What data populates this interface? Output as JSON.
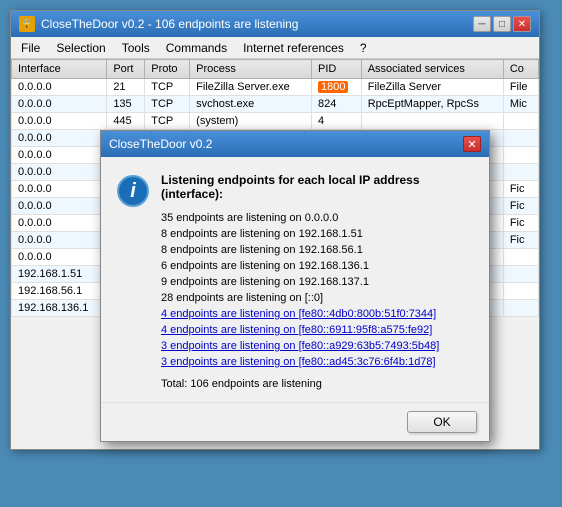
{
  "mainWindow": {
    "title": "CloseTheDoor v0.2 - 106 endpoints are listening",
    "icon": "🔒"
  },
  "menuBar": {
    "items": [
      "File",
      "Selection",
      "Tools",
      "Commands",
      "Internet references",
      "?"
    ]
  },
  "table": {
    "columns": [
      "Interface",
      "Port",
      "Proto",
      "Process",
      "PID",
      "Associated services",
      "Co"
    ],
    "rows": [
      {
        "interface": "0.0.0.0",
        "port": "21",
        "proto": "TCP",
        "process": "FileZilla Server.exe",
        "pid": "1800",
        "pid_highlight": true,
        "services": "FileZilla Server",
        "co": "File",
        "selected": false
      },
      {
        "interface": "0.0.0.0",
        "port": "135",
        "proto": "TCP",
        "process": "svchost.exe",
        "pid": "824",
        "pid_highlight": false,
        "services": "RpcEptMapper, RpcSs",
        "co": "Mic",
        "selected": false
      },
      {
        "interface": "0.0.0.0",
        "port": "445",
        "proto": "TCP",
        "process": "(system)",
        "pid": "4",
        "pid_highlight": false,
        "services": "",
        "co": "",
        "selected": false
      },
      {
        "interface": "0.0.0.0",
        "port": "",
        "proto": "",
        "process": "",
        "pid": "",
        "pid_highlight": false,
        "services": "",
        "co": "",
        "selected": false
      },
      {
        "interface": "0.0.0.0",
        "port": "",
        "proto": "",
        "process": "",
        "pid": "",
        "pid_highlight": false,
        "services": "",
        "co": "",
        "selected": false
      },
      {
        "interface": "0.0.0.0",
        "port": "",
        "proto": "",
        "process": "",
        "pid": "",
        "pid_highlight": false,
        "services": "",
        "co": "",
        "selected": false
      },
      {
        "interface": "0.0.0.0",
        "port": "",
        "proto": "",
        "process": "",
        "pid": "",
        "pid_highlight": false,
        "services": "",
        "co": "Fic",
        "selected": false
      },
      {
        "interface": "0.0.0.0",
        "port": "",
        "proto": "",
        "process": "",
        "pid": "",
        "pid_highlight": false,
        "services": "",
        "co": "Fic",
        "selected": false
      },
      {
        "interface": "0.0.0.0",
        "port": "",
        "proto": "",
        "process": "",
        "pid": "",
        "pid_highlight": false,
        "services": "",
        "co": "Fic",
        "selected": false
      },
      {
        "interface": "0.0.0.0",
        "port": "",
        "proto": "",
        "process": "",
        "pid": "",
        "pid_highlight": false,
        "services": "",
        "co": "Fic",
        "selected": false
      },
      {
        "interface": "0.0.0.0",
        "port": "",
        "proto": "",
        "process": "",
        "pid": "",
        "pid_highlight": false,
        "services": "",
        "co": "",
        "selected": false
      },
      {
        "interface": "192.168.1.51",
        "port": "",
        "proto": "",
        "process": "",
        "pid": "",
        "pid_highlight": false,
        "services": "",
        "co": "",
        "selected": false
      },
      {
        "interface": "192.168.56.1",
        "port": "",
        "proto": "",
        "process": "",
        "pid": "",
        "pid_highlight": false,
        "services": "",
        "co": "",
        "selected": false
      },
      {
        "interface": "192.168.136.1",
        "port": "",
        "proto": "",
        "process": "",
        "pid": "",
        "pid_highlight": false,
        "services": "",
        "co": "",
        "selected": false
      }
    ]
  },
  "modal": {
    "title": "CloseTheDoor v0.2",
    "heading": "Listening endpoints for each local IP address (interface):",
    "infoIcon": "i",
    "lines": [
      {
        "text": "35 endpoints are listening on 0.0.0.0",
        "isLink": false
      },
      {
        "text": "8 endpoints are listening on 192.168.1.51",
        "isLink": false
      },
      {
        "text": "8 endpoints are listening on 192.168.56.1",
        "isLink": false
      },
      {
        "text": "6 endpoints are listening on 192.168.136.1",
        "isLink": false
      },
      {
        "text": "9 endpoints are listening on 192.168.137.1",
        "isLink": false
      },
      {
        "text": "28 endpoints are listening on [::0]",
        "isLink": false
      },
      {
        "text": "4 endpoints are listening on [fe80::4db0:800b:51f0:7344]",
        "isLink": true
      },
      {
        "text": "4 endpoints are listening on [fe80::6911:95f8:a575:fe92]",
        "isLink": true
      },
      {
        "text": "3 endpoints are listening on [fe80::a929:63b5:7493:5b48]",
        "isLink": true
      },
      {
        "text": "3 endpoints are listening on [fe80::ad45:3c76:6f4b:1d78]",
        "isLink": true
      }
    ],
    "total": "Total: 106 endpoints are listening",
    "okButton": "OK"
  }
}
